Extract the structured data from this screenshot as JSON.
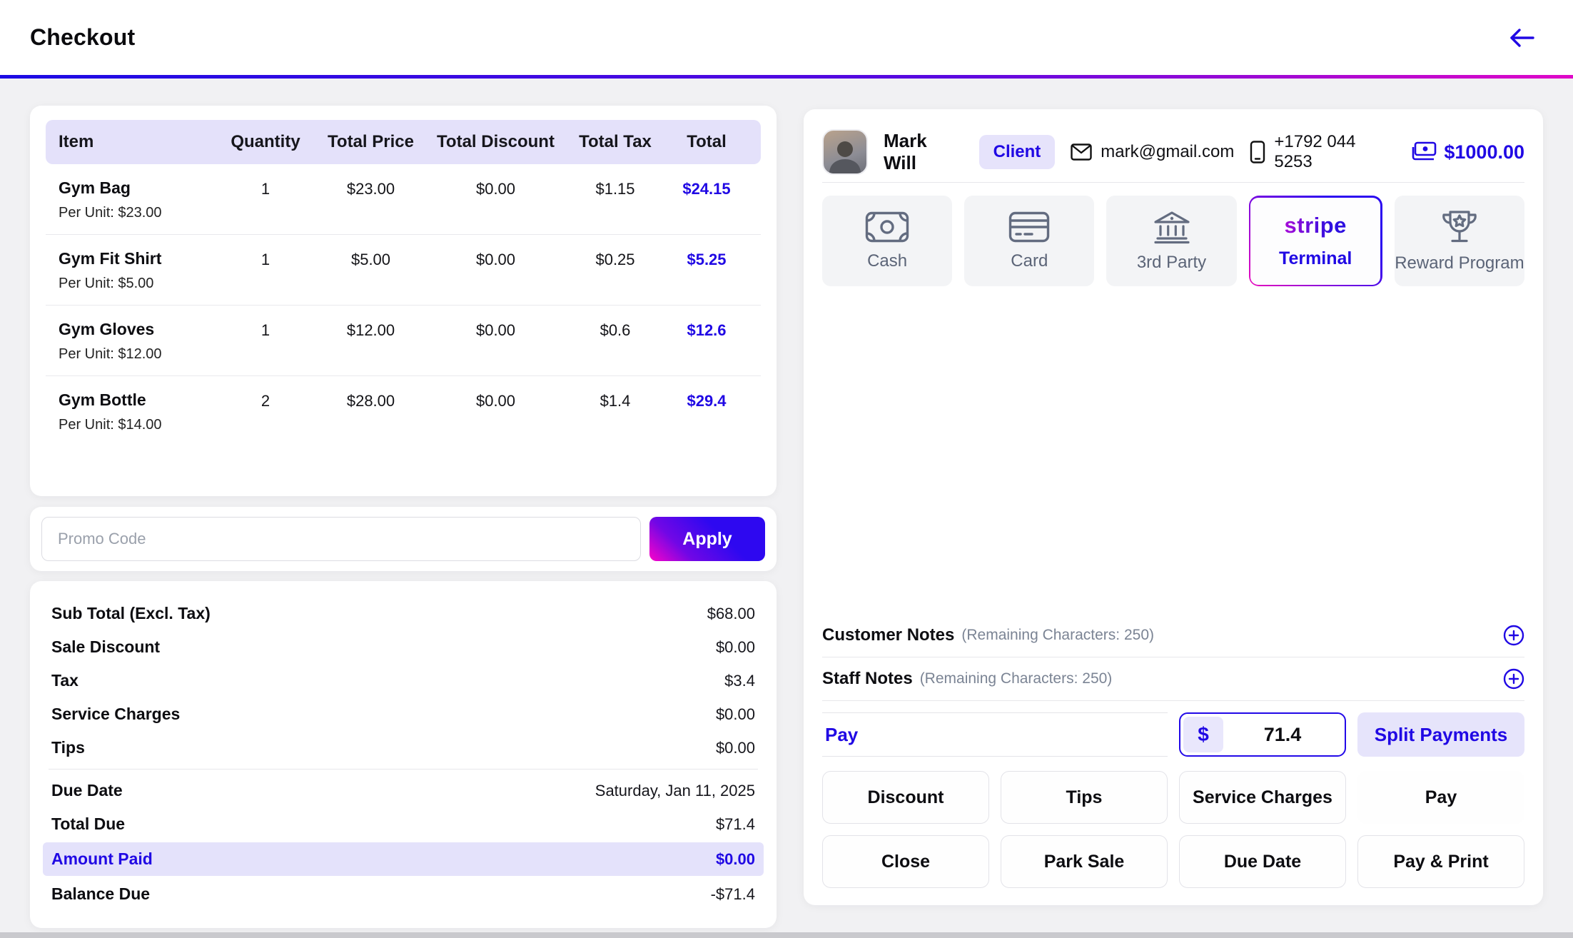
{
  "header": {
    "title": "Checkout"
  },
  "items_table": {
    "columns": [
      "Item",
      "Quantity",
      "Total Price",
      "Total Discount",
      "Total Tax",
      "Total"
    ],
    "rows": [
      {
        "name": "Gym Bag",
        "per_unit": "Per Unit: $23.00",
        "quantity": "1",
        "total_price": "$23.00",
        "total_discount": "$0.00",
        "total_tax": "$1.15",
        "total": "$24.15"
      },
      {
        "name": "Gym Fit Shirt",
        "per_unit": "Per Unit: $5.00",
        "quantity": "1",
        "total_price": "$5.00",
        "total_discount": "$0.00",
        "total_tax": "$0.25",
        "total": "$5.25"
      },
      {
        "name": "Gym Gloves",
        "per_unit": "Per Unit: $12.00",
        "quantity": "1",
        "total_price": "$12.00",
        "total_discount": "$0.00",
        "total_tax": "$0.6",
        "total": "$12.6"
      },
      {
        "name": "Gym Bottle",
        "per_unit": "Per Unit: $14.00",
        "quantity": "2",
        "total_price": "$28.00",
        "total_discount": "$0.00",
        "total_tax": "$1.4",
        "total": "$29.4"
      }
    ]
  },
  "promo": {
    "placeholder": "Promo Code",
    "apply_label": "Apply"
  },
  "summary": {
    "rows": [
      {
        "label": "Sub Total (Excl. Tax)",
        "value": "$68.00"
      },
      {
        "label": "Sale Discount",
        "value": "$0.00"
      },
      {
        "label": "Tax",
        "value": "$3.4"
      },
      {
        "label": "Service Charges",
        "value": "$0.00"
      },
      {
        "label": "Tips",
        "value": "$0.00"
      },
      {
        "label": "Due Date",
        "value": "Saturday, Jan 11, 2025"
      },
      {
        "label": "Total Due",
        "value": "$71.4"
      },
      {
        "label": "Amount Paid",
        "value": "$0.00"
      },
      {
        "label": "Balance Due",
        "value": "-$71.4"
      }
    ]
  },
  "client": {
    "name": "Mark Will",
    "badge": "Client",
    "email": "mark@gmail.com",
    "phone": "+1792 044 5253",
    "balance": "$1000.00"
  },
  "payment_methods": [
    {
      "label": "Cash",
      "icon": "cash-icon"
    },
    {
      "label": "Card",
      "icon": "card-icon"
    },
    {
      "label": "3rd Party",
      "icon": "bank-icon"
    },
    {
      "label": "Terminal",
      "brand": "stripe",
      "selected": true
    },
    {
      "label": "Reward Program",
      "icon": "trophy-icon"
    }
  ],
  "notes": {
    "customer_label": "Customer Notes",
    "customer_hint": "(Remaining Characters: 250)",
    "staff_label": "Staff Notes",
    "staff_hint": "(Remaining Characters: 250)"
  },
  "pay_section": {
    "label": "Pay",
    "currency": "$",
    "amount": "71.4",
    "split_label": "Split Payments"
  },
  "action_buttons": [
    {
      "label": "Discount"
    },
    {
      "label": "Tips"
    },
    {
      "label": "Service Charges"
    },
    {
      "label": "Pay",
      "primary": true
    },
    {
      "label": "Close"
    },
    {
      "label": "Park Sale"
    },
    {
      "label": "Due Date"
    },
    {
      "label": "Pay & Print"
    }
  ],
  "colors": {
    "accent_blue": "#2008e4",
    "accent_magenta": "#e90bbd",
    "lavender": "#e6e3fb"
  }
}
